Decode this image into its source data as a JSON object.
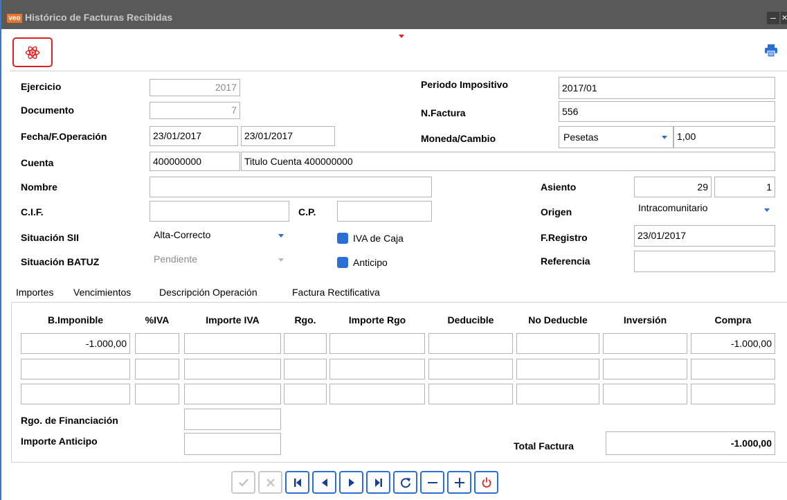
{
  "window": {
    "title": "Histórico de Facturas Recibidas",
    "logo": "veo",
    "minimize": "–",
    "close": "×"
  },
  "toolbar": {
    "atom_icon": "atom-icon",
    "print_icon": "printer-icon"
  },
  "form": {
    "ejercicio": {
      "label": "Ejercicio",
      "value": "2017"
    },
    "documento": {
      "label": "Documento",
      "value": "7"
    },
    "fecha": {
      "label": "Fecha/F.Operación",
      "value1": "23/01/2017",
      "value2": "23/01/2017"
    },
    "cuenta": {
      "label": "Cuenta",
      "value": "400000000",
      "title": "Titulo Cuenta 400000000"
    },
    "nombre": {
      "label": "Nombre",
      "value": ""
    },
    "cif": {
      "label": "C.I.F.",
      "value": ""
    },
    "cp": {
      "label": "C.P.",
      "value": ""
    },
    "situacion_sii": {
      "label": "Situación SII",
      "value": "Alta-Correcto"
    },
    "situacion_batuz": {
      "label": "Situación BATUZ",
      "value": "Pendiente"
    },
    "iva_caja": {
      "label": "IVA de Caja"
    },
    "anticipo": {
      "label": "Anticipo"
    },
    "periodo": {
      "label": "Periodo Impositivo",
      "value": "2017/01"
    },
    "nfactura": {
      "label": "N.Factura",
      "value": "556"
    },
    "moneda": {
      "label": "Moneda/Cambio",
      "value": "Pesetas",
      "cambio": "1,00"
    },
    "asiento": {
      "label": "Asiento",
      "value1": "29",
      "value2": "1"
    },
    "origen": {
      "label": "Origen",
      "value": "Intracomunitario"
    },
    "fregistro": {
      "label": "F.Registro",
      "value": "23/01/2017"
    },
    "referencia": {
      "label": "Referencia",
      "value": ""
    }
  },
  "tabs": [
    "Importes",
    "Vencimientos",
    "Descripción Operación",
    "Factura Rectificativa"
  ],
  "table": {
    "headers": [
      "B.Imponible",
      "%IVA",
      "Importe IVA",
      "Rgo.",
      "Importe Rgo",
      "Deducible",
      "No Deducble",
      "Inversión",
      "Compra"
    ],
    "rows": [
      [
        "-1.000,00",
        "",
        "",
        "",
        "",
        "",
        "",
        "",
        "-1.000,00"
      ],
      [
        "",
        "",
        "",
        "",
        "",
        "",
        "",
        "",
        ""
      ],
      [
        "",
        "",
        "",
        "",
        "",
        "",
        "",
        "",
        ""
      ]
    ]
  },
  "footer": {
    "rgo_financiacion": {
      "label": "Rgo. de Financiación",
      "value": ""
    },
    "importe_anticipo": {
      "label": "Importe Anticipo",
      "value": ""
    },
    "total_factura": {
      "label": "Total Factura",
      "value": "-1.000,00"
    }
  },
  "nav_buttons": [
    "confirm-icon",
    "cancel-icon",
    "first-record-icon",
    "previous-record-icon",
    "next-record-icon",
    "last-record-icon",
    "refresh-icon",
    "delete-record-icon",
    "add-record-icon",
    "power-icon"
  ],
  "colors": {
    "accent": "#2a6fd6",
    "titlebar": "#595959",
    "highlight_red": "#e02020"
  }
}
